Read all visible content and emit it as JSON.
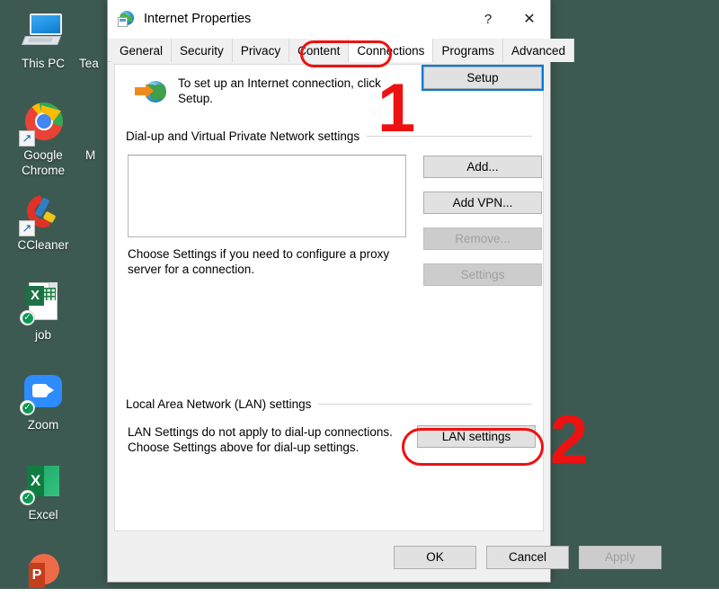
{
  "desktop": {
    "background_color": "#3d5a52",
    "icons": [
      {
        "label": "This PC",
        "icon": "this-pc-icon",
        "badge": "none"
      },
      {
        "label": "Google Chrome",
        "icon": "chrome-icon",
        "badge": "shortcut"
      },
      {
        "label": "CCleaner",
        "icon": "ccleaner-icon",
        "badge": "shortcut"
      },
      {
        "label": "job",
        "icon": "excel-file-icon",
        "badge": "sync-check"
      },
      {
        "label": "Zoom",
        "icon": "zoom-icon",
        "badge": "sync-check"
      },
      {
        "label": "Excel",
        "icon": "excel-app-icon",
        "badge": "sync-check"
      },
      {
        "label": "",
        "icon": "powerpoint-icon",
        "badge": "none"
      }
    ],
    "partial_labels": [
      "Tea",
      "M"
    ]
  },
  "dialog": {
    "title": "Internet Properties",
    "title_icon": "internet-properties-icon",
    "help_button": "?",
    "close_button": "✕",
    "tabs": [
      {
        "label": "General",
        "active": false
      },
      {
        "label": "Security",
        "active": false
      },
      {
        "label": "Privacy",
        "active": false
      },
      {
        "label": "Content",
        "active": false
      },
      {
        "label": "Connections",
        "active": true
      },
      {
        "label": "Programs",
        "active": false
      },
      {
        "label": "Advanced",
        "active": false
      }
    ],
    "setup": {
      "icon": "globe-arrow-icon",
      "text": "To set up an Internet connection, click Setup.",
      "button_label": "Setup",
      "button_focused": true
    },
    "dialup_group": {
      "title": "Dial-up and Virtual Private Network settings",
      "list_items": [],
      "buttons": [
        {
          "label": "Add...",
          "disabled": false
        },
        {
          "label": "Add VPN...",
          "disabled": false
        },
        {
          "label": "Remove...",
          "disabled": true
        },
        {
          "label": "Settings",
          "disabled": true
        }
      ],
      "proxy_note": "Choose Settings if you need to configure a proxy server for a connection."
    },
    "lan_group": {
      "title": "Local Area Network (LAN) settings",
      "note": "LAN Settings do not apply to dial-up connections. Choose Settings above for dial-up settings.",
      "button_label": "LAN settings"
    },
    "footer": {
      "ok": "OK",
      "cancel": "Cancel",
      "apply": "Apply",
      "apply_disabled": true
    }
  },
  "annotations": {
    "accent_color": "#ee1111",
    "markers": [
      {
        "number": "1",
        "target": "connections-tab"
      },
      {
        "number": "2",
        "target": "lan-settings-button"
      }
    ]
  }
}
